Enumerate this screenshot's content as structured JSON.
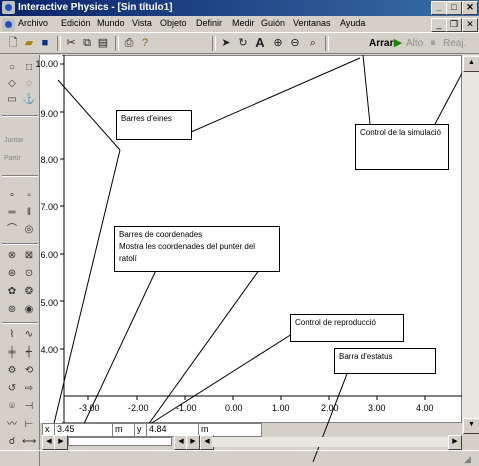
{
  "window": {
    "title": "Interactive Physics - [Sin título1]"
  },
  "menu": [
    "Archivo",
    "Edición",
    "Mundo",
    "Vista",
    "Objeto",
    "Definir",
    "Medir",
    "Guión",
    "Ventanas",
    "Ayuda"
  ],
  "toolbar": {
    "run": "Arrar",
    "stop": "Alto",
    "reset": "Reaj."
  },
  "palette": {
    "join": "Juntar",
    "split": "Partir"
  },
  "ruler": {
    "y": [
      "10.00",
      "9.00",
      "8.00",
      "7.00",
      "6.00",
      "5.00",
      "4.00"
    ],
    "x": [
      "-3.00",
      "-2.00",
      "-1.00",
      "0.00",
      "1.00",
      "2.00",
      "3.00",
      "4.00"
    ]
  },
  "callouts": {
    "toolbars": "Barres d'eines",
    "sim_control": "Control de la simulació",
    "coord_title": "Barres de coordenades",
    "coord_desc": "Mostra les coordenades del punter del ratolí",
    "playback": "Control de reproducció",
    "status": "Barra d'estatus"
  },
  "coords": {
    "x_label": "x",
    "x_value": "3.45",
    "x_unit": "m",
    "y_label": "y",
    "y_value": "4.84",
    "y_unit": "m"
  }
}
